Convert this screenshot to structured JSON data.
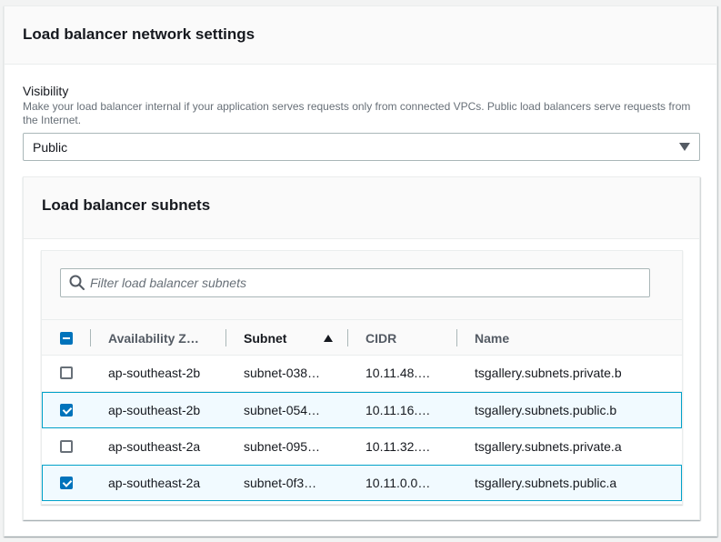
{
  "section": {
    "title": "Load balancer network settings"
  },
  "visibility": {
    "label": "Visibility",
    "description": "Make your load balancer internal if your application serves requests only from connected VPCs. Public load balancers serve requests from the Internet.",
    "selected": "Public"
  },
  "subnets": {
    "title": "Load balancer subnets",
    "filter_placeholder": "Filter load balancer subnets",
    "columns": {
      "az": "Availability Z…",
      "subnet": "Subnet",
      "cidr": "CIDR",
      "name": "Name"
    },
    "sort": {
      "column": "Subnet",
      "direction": "ascending"
    },
    "header_checkbox": "indeterminate",
    "rows": [
      {
        "az": "ap-southeast-2b",
        "subnet": "subnet-038…",
        "cidr": "10.11.48.…",
        "name": "tsgallery.subnets.private.b",
        "checked": false
      },
      {
        "az": "ap-southeast-2b",
        "subnet": "subnet-054…",
        "cidr": "10.11.16.…",
        "name": "tsgallery.subnets.public.b",
        "checked": true
      },
      {
        "az": "ap-southeast-2a",
        "subnet": "subnet-095…",
        "cidr": "10.11.32.…",
        "name": "tsgallery.subnets.private.a",
        "checked": false
      },
      {
        "az": "ap-southeast-2a",
        "subnet": "subnet-0f3…",
        "cidr": "10.11.0.0…",
        "name": "tsgallery.subnets.public.a",
        "checked": true
      }
    ]
  },
  "colors": {
    "accent": "#0073bb",
    "selected_row_border": "#00a1c9",
    "selected_row_bg": "#f1faff"
  },
  "icons": {
    "filter": "search-icon",
    "select_caret": "caret-down-icon",
    "sort": "sort-ascending-icon"
  }
}
